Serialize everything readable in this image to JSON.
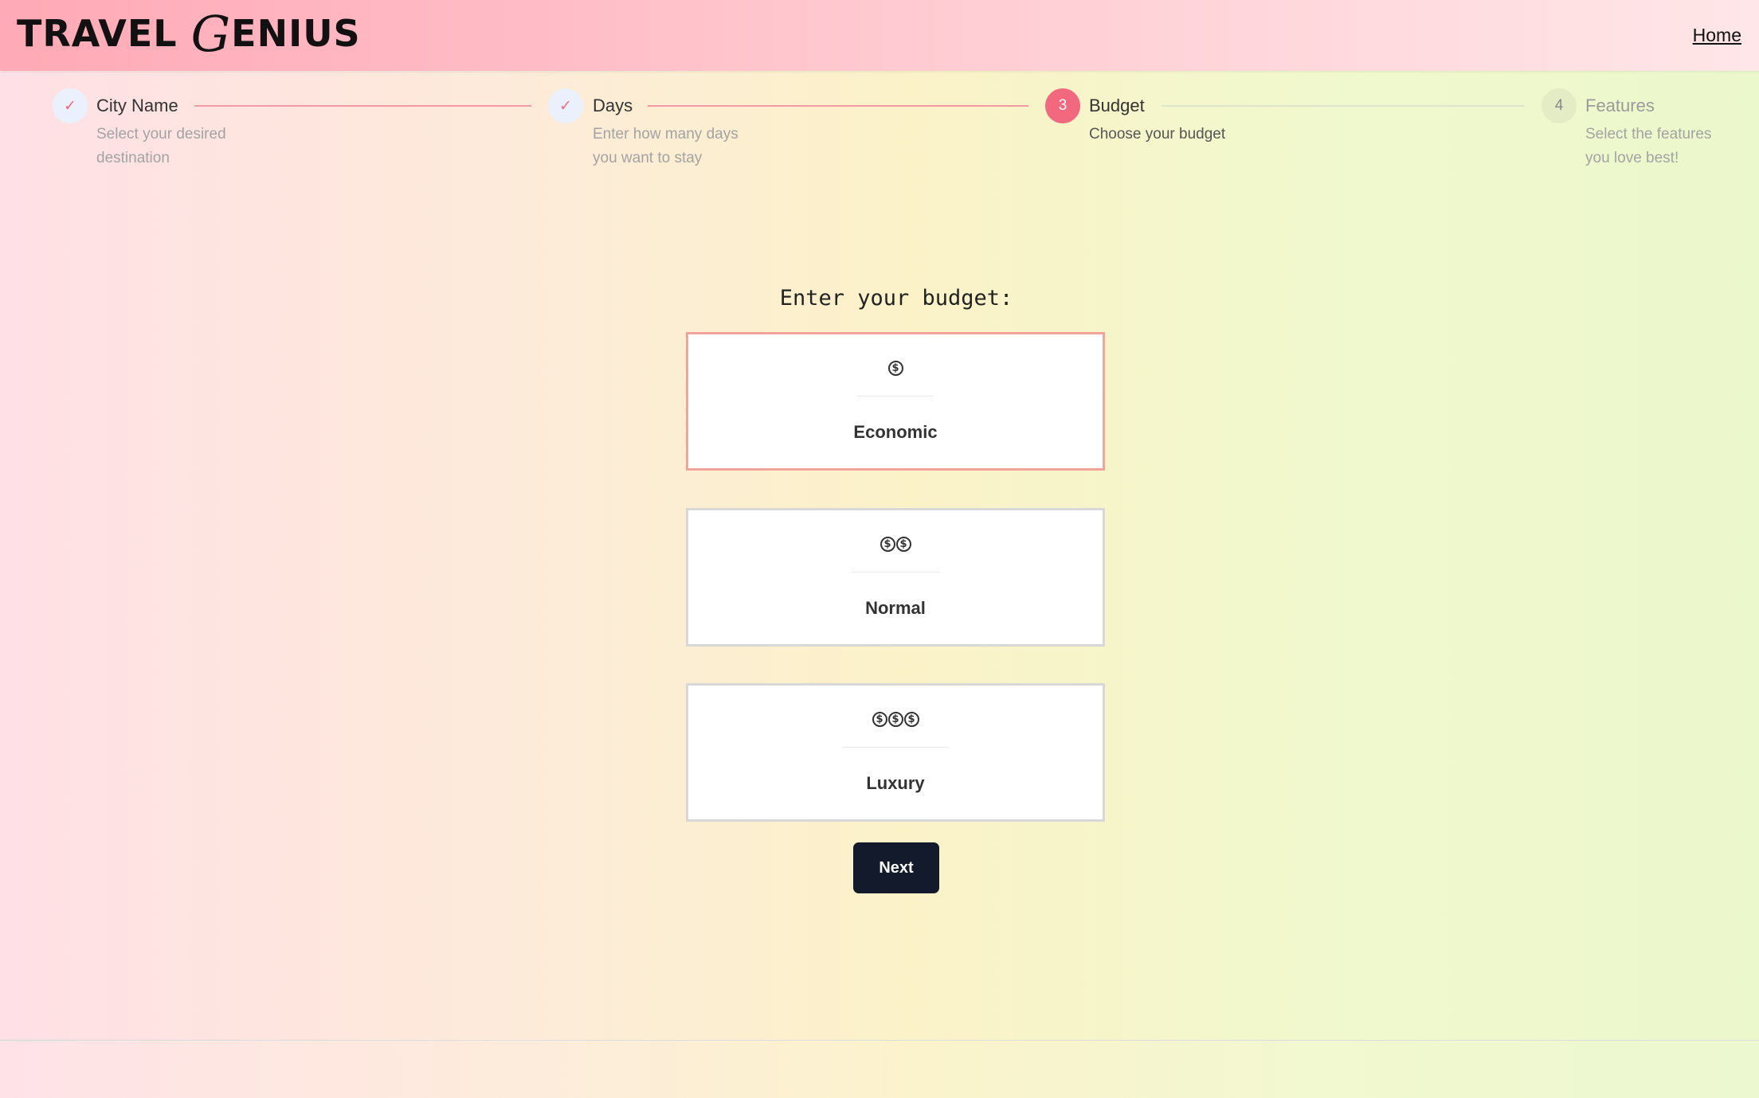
{
  "header": {
    "logo_part1": "TRAVEL ",
    "logo_g": "G",
    "logo_part2": "ENIUS",
    "home_link": "Home"
  },
  "stepper": {
    "steps": [
      {
        "title": "City Name",
        "desc": "Select your desired destination",
        "state": "done",
        "marker": "✓"
      },
      {
        "title": "Days",
        "desc": "Enter how many days you want to stay",
        "state": "done",
        "marker": "✓"
      },
      {
        "title": "Budget",
        "desc": "Choose your budget",
        "state": "active",
        "marker": "3"
      },
      {
        "title": "Features",
        "desc": "Select the features you love best!",
        "state": "pending",
        "marker": "4"
      }
    ]
  },
  "budget": {
    "question": "Enter your budget:",
    "coin_symbol": "$",
    "options": [
      {
        "label": "Economic",
        "coins": 1,
        "selected": true
      },
      {
        "label": "Normal",
        "coins": 2,
        "selected": false
      },
      {
        "label": "Luxury",
        "coins": 3,
        "selected": false
      }
    ],
    "next_label": "Next"
  },
  "colors": {
    "accent": "#f2687f",
    "selected_border": "#f4a39a",
    "button_bg": "#131a2b"
  }
}
